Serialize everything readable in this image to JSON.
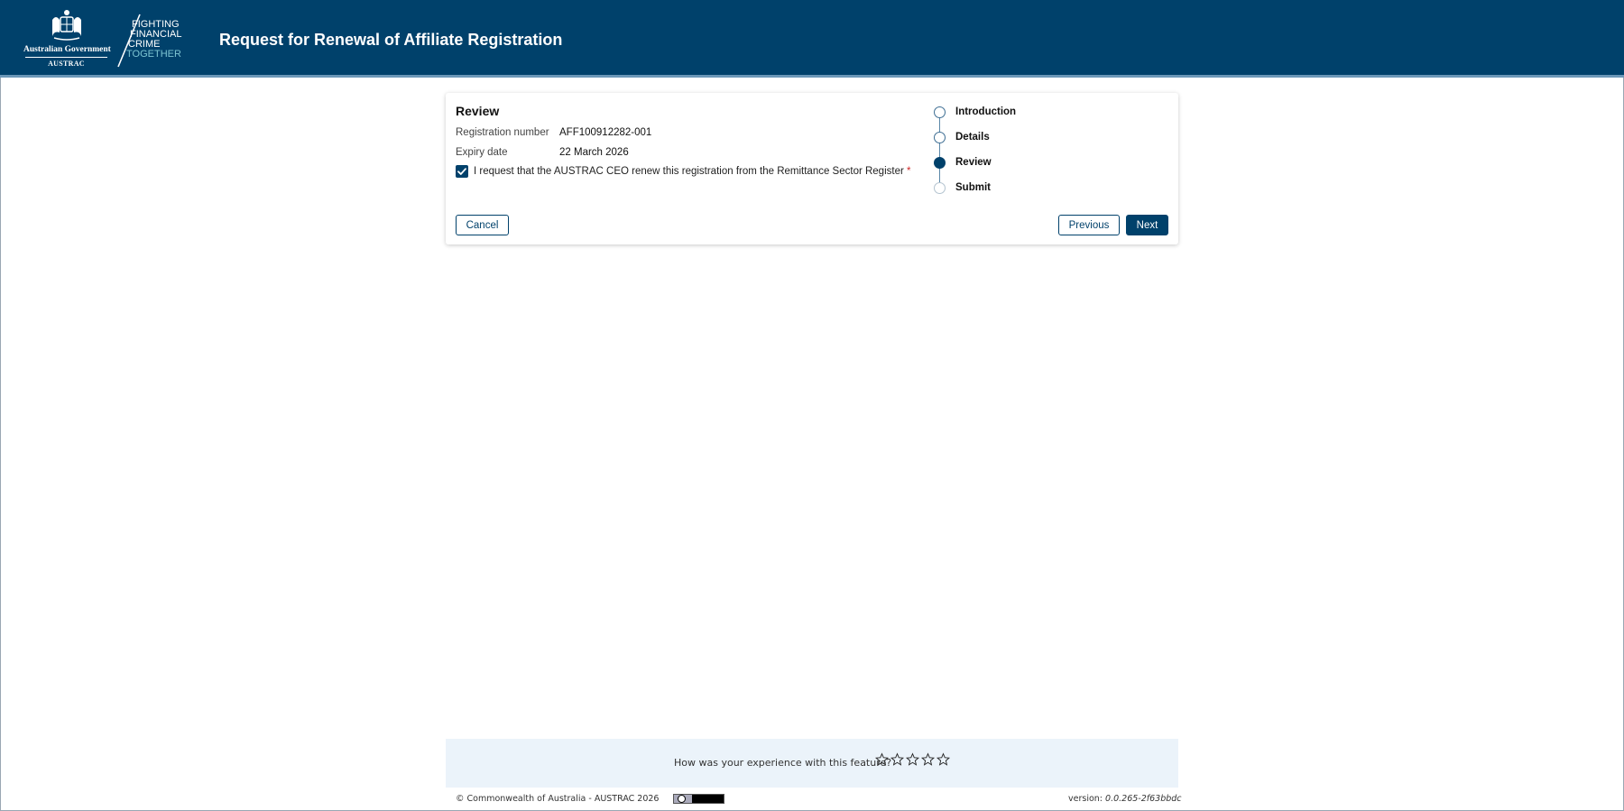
{
  "header": {
    "government": "Australian Government",
    "agency": "AUSTRAC",
    "tagline": [
      "FIGHTING",
      "FINANCIAL",
      "CRIME",
      "TOGETHER"
    ],
    "title": "Request for Renewal of Affiliate Registration"
  },
  "review": {
    "heading": "Review",
    "registration_number_label": "Registration number",
    "registration_number_value": "AFF100912282-001",
    "expiry_date_label": "Expiry date",
    "expiry_date_value": "22 March 2026",
    "consent_label": "I request that the AUSTRAC CEO renew this registration from the Remittance Sector Register",
    "consent_required_marker": "*",
    "consent_checked": true
  },
  "buttons": {
    "cancel": "Cancel",
    "previous": "Previous",
    "next": "Next"
  },
  "stepper": {
    "steps": [
      {
        "label": "Introduction",
        "state": "complete"
      },
      {
        "label": "Details",
        "state": "complete"
      },
      {
        "label": "Review",
        "state": "current"
      },
      {
        "label": "Submit",
        "state": "upcoming"
      }
    ]
  },
  "feedback": {
    "question": "How was your experience with this feature?",
    "max_rating": 5,
    "rating": 0
  },
  "footer": {
    "copyright": "© Commonwealth of Australia - AUSTRAC 2026",
    "version_label": "version:",
    "version_value": "0.0.265-2f63bbdc"
  },
  "colors": {
    "brand": "#00416b",
    "header_bg": "#00416b",
    "tagline_accent": "#7ec5d3",
    "required": "#d02828",
    "feedback_bg": "#ebf3fa"
  },
  "icons": {
    "crest": "coat-of-arms-icon",
    "checkbox": "check-icon",
    "rating": "star-outline-icon",
    "license": "creative-commons-icon"
  }
}
